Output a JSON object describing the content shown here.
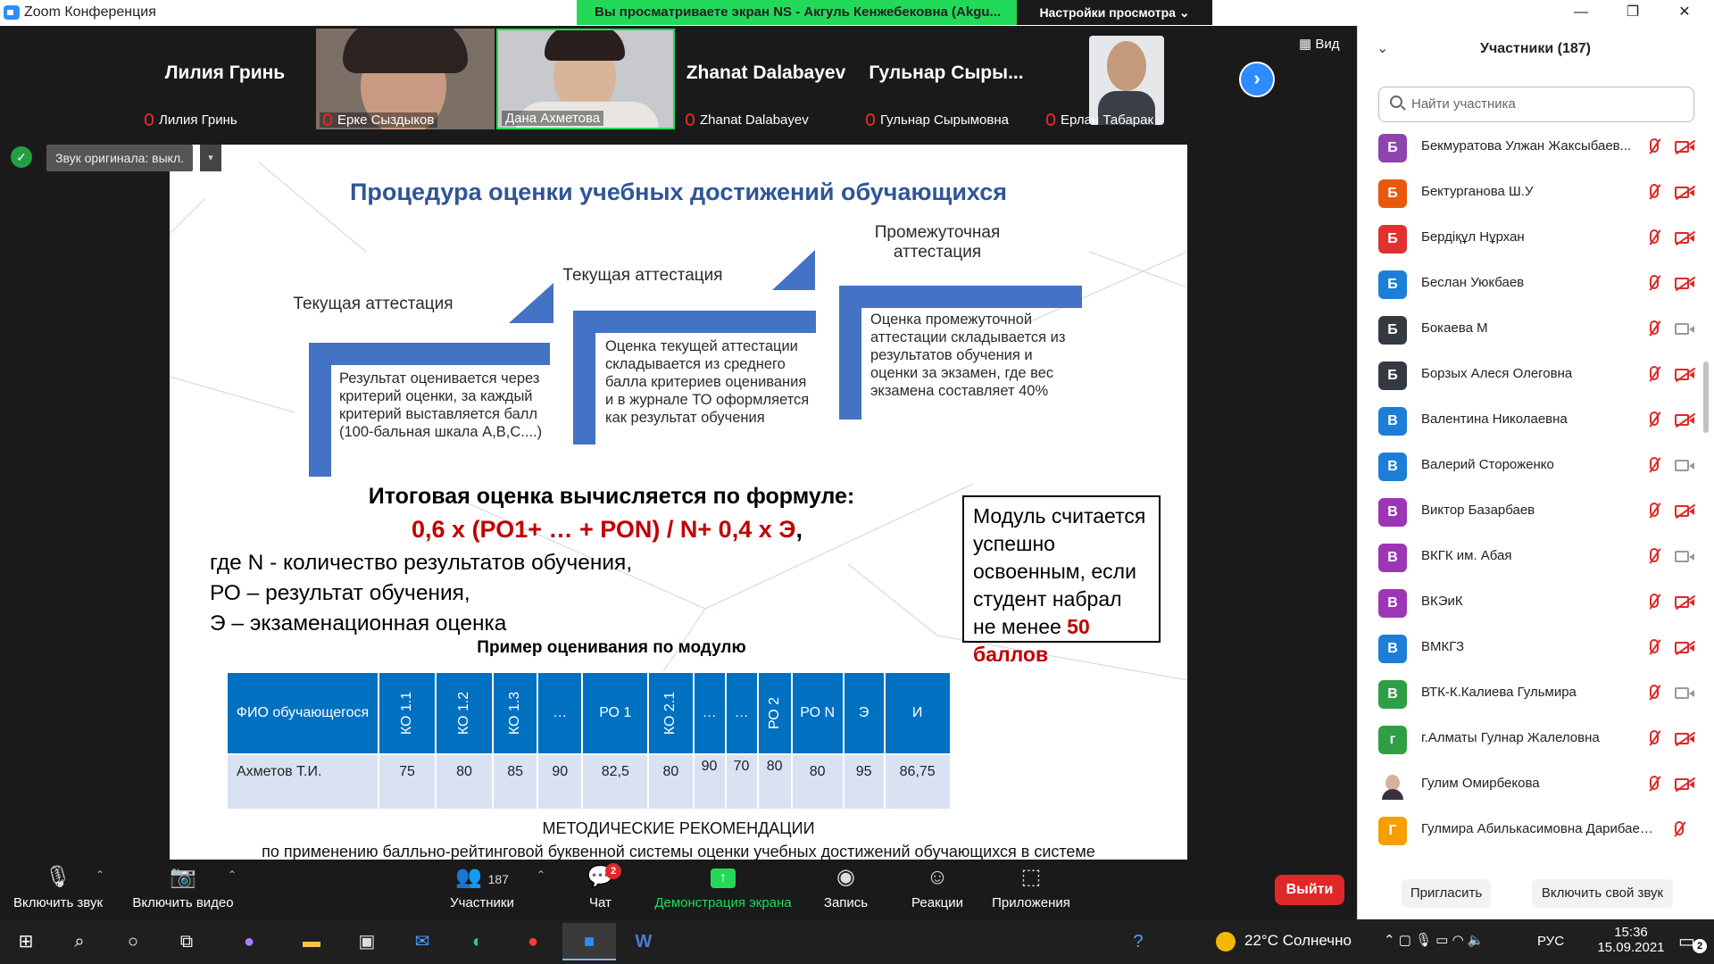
{
  "window": {
    "title": "Zoom Конференция",
    "share_banner": "Вы просматриваете экран NS - Акгуль Кенжебековна (Akgu...",
    "view_options": "Настройки просмотра",
    "view_button": "Вид",
    "min": "—",
    "max": "❐",
    "close": "✕"
  },
  "thumbnails": [
    {
      "big": "Лилия Гринь",
      "label": "Лилия Гринь",
      "video": false
    },
    {
      "big": "",
      "label": "Ерке Сыздыков",
      "video": true
    },
    {
      "big": "",
      "label": "Дана Ахметова",
      "video": true
    },
    {
      "big": "Zhanat Dalabayev",
      "label": "Zhanat Dalabayev",
      "video": false
    },
    {
      "big": "Гульнар  Сыры...",
      "label": "Гульнар Сырымовна",
      "video": false
    },
    {
      "big": "",
      "label": "Ерлан Табарак",
      "video": true
    }
  ],
  "audio_notice": "Звук оригинала: выкл.",
  "slide": {
    "title": "Процедура оценки учебных достижений обучающихся",
    "stages": [
      {
        "heading": "Текущая аттестация",
        "text": "Результат оценивается через критерий оценки, за каждый критерий выставляется балл (100-бальная шкала A,B,C....)"
      },
      {
        "heading": "Текущая аттестация",
        "text": "Оценка текущей аттестации складывается из среднего балла критериев оценивания и в журнале ТО оформляется как результат обучения"
      },
      {
        "heading": "Промежуточная аттестация",
        "text": "Оценка промежуточной аттестации складывается из результатов обучения и оценки за экзамен, где вес экзамена составляет 40%"
      }
    ],
    "formula_heading": "Итоговая оценка вычисляется по формуле:",
    "formula": "0,6 х (РО1+ … + РОN) / N+ 0,4 х Э",
    "formula_tail": ",",
    "definitions": [
      "где N - количество результатов обучения,",
      "РО – результат обучения,",
      "Э – экзаменационная оценка"
    ],
    "note": "Модуль считается успешно освоенным, если студент набрал не менее",
    "note_highlight": "50 баллов",
    "example_heading": "Пример оценивания по модулю",
    "table_headers": [
      "ФИО обучающегося",
      "КО 1.1",
      "КО 1.2",
      "КО 1.3",
      "…",
      "РО 1",
      "КО 2.1",
      "…",
      "…",
      "РО 2",
      "РО N",
      "Э",
      "И"
    ],
    "table_row": [
      "Ахметов Т.И.",
      "75",
      "80",
      "85",
      "90",
      "82,5",
      "80",
      "90",
      "70",
      "80",
      "80",
      "95",
      "86,75"
    ],
    "footer1": "МЕТОДИЧЕСКИЕ РЕКОМЕНДАЦИИ",
    "footer2": "по применению балльно-рейтинговой буквенной системы оценки учебных достижений обучающихся в системе"
  },
  "toolbar": {
    "unmute": "Включить звук",
    "start_video": "Включить видео",
    "participants": "Участники",
    "participants_count": "187",
    "chat": "Чат",
    "chat_badge": "2",
    "share": "Демонстрация экрана",
    "record": "Запись",
    "reactions": "Реакции",
    "apps": "Приложения",
    "leave": "Выйти"
  },
  "panel": {
    "header": "Участники (187)",
    "search_placeholder": "Найти участника",
    "invite": "Пригласить",
    "unmute_self": "Включить свой звук",
    "participants": [
      {
        "initial": "Б",
        "name": "Бекмуратова Улжан Жаксыбаев...",
        "color": "#8e44ad",
        "cam": "off"
      },
      {
        "initial": "Б",
        "name": "Бектурганова Ш.У",
        "color": "#e8590c",
        "cam": "off"
      },
      {
        "initial": "Б",
        "name": "Бердіқұл Нұрхан",
        "color": "#e03131",
        "cam": "off"
      },
      {
        "initial": "Б",
        "name": "Беслан Уюкбаев",
        "color": "#1c7ed6",
        "cam": "off"
      },
      {
        "initial": "Б",
        "name": "Бокаева М",
        "color": "#343a40",
        "cam": "on"
      },
      {
        "initial": "Б",
        "name": "Борзых Алеся Олеговна",
        "color": "#343a40",
        "cam": "off"
      },
      {
        "initial": "В",
        "name": "Валентина Николаевна",
        "color": "#1c7ed6",
        "cam": "off"
      },
      {
        "initial": "В",
        "name": "Валерий Стороженко",
        "color": "#1c7ed6",
        "cam": "on"
      },
      {
        "initial": "В",
        "name": "Виктор Базарбаев",
        "color": "#9c36b5",
        "cam": "off"
      },
      {
        "initial": "В",
        "name": "ВКГК им. Абая",
        "color": "#9c36b5",
        "cam": "on"
      },
      {
        "initial": "В",
        "name": "ВКЭиК",
        "color": "#9c36b5",
        "cam": "off"
      },
      {
        "initial": "В",
        "name": "ВМКГЗ",
        "color": "#1c7ed6",
        "cam": "off"
      },
      {
        "initial": "В",
        "name": "ВТК-К.Калиева Гульмира",
        "color": "#2f9e44",
        "cam": "on"
      },
      {
        "initial": "г",
        "name": "г.Алматы Гулнар Жалеловна",
        "color": "#2f9e44",
        "cam": "off"
      },
      {
        "initial": "",
        "name": "Гулим Омирбекова",
        "color": "#6d5d6e",
        "cam": "off"
      },
      {
        "initial": "Г",
        "name": "Гулмира Абилькасимовна Дарибаев...",
        "color": "#f59f00",
        "cam": "none"
      }
    ]
  },
  "taskbar": {
    "weather": "22°C  Солнечно",
    "lang": "РУС",
    "time": "15:36",
    "date": "15.09.2021",
    "notif_badge": "2"
  }
}
